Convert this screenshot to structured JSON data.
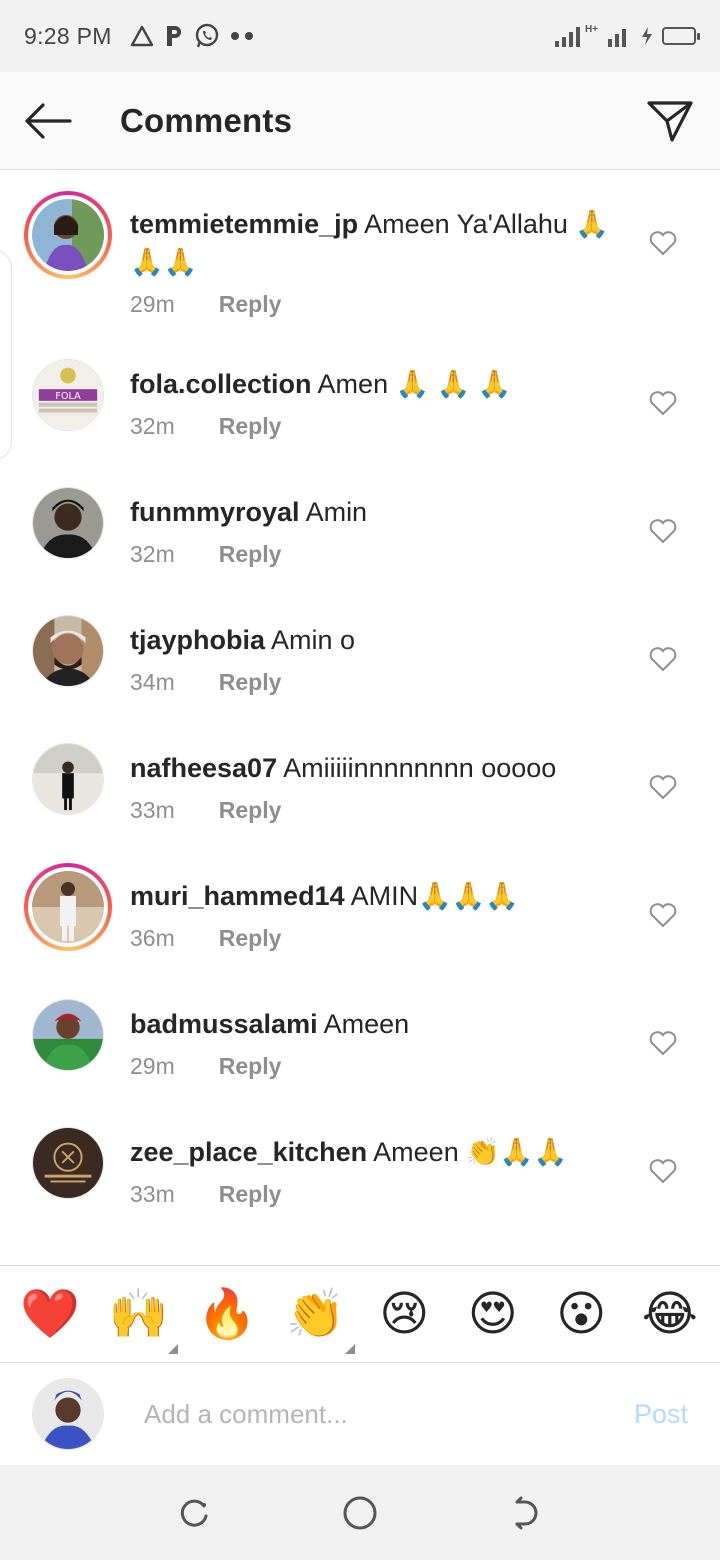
{
  "status_bar": {
    "time": "9:28 PM",
    "network": "H+",
    "icons": [
      "alert-triangle-icon",
      "p-app-icon",
      "whatsapp-icon",
      "more-dots-icon",
      "signal-icon",
      "battery-icon"
    ]
  },
  "header": {
    "title": "Comments",
    "back_icon": "arrow-left-icon",
    "share_icon": "paper-plane-icon"
  },
  "comments": [
    {
      "username": "temmietemmie_jp",
      "text": "Ameen Ya'Allahu 🙏🙏🙏",
      "time": "29m",
      "reply_label": "Reply",
      "has_story": true
    },
    {
      "username": "fola.collection",
      "text": "Amen 🙏 🙏 🙏",
      "time": "32m",
      "reply_label": "Reply",
      "has_story": false
    },
    {
      "username": "funmmyroyal",
      "text": "Amin",
      "time": "32m",
      "reply_label": "Reply",
      "has_story": false
    },
    {
      "username": "tjayphobia",
      "text": "Amin o",
      "time": "34m",
      "reply_label": "Reply",
      "has_story": false
    },
    {
      "username": "nafheesa07",
      "text": "Amiiiiinnnnnnnn ooooo",
      "time": "33m",
      "reply_label": "Reply",
      "has_story": false
    },
    {
      "username": "muri_hammed14",
      "text": "AMIN🙏🙏🙏",
      "time": "36m",
      "reply_label": "Reply",
      "has_story": true
    },
    {
      "username": "badmussalami",
      "text": "Ameen",
      "time": "29m",
      "reply_label": "Reply",
      "has_story": false
    },
    {
      "username": "zee_place_kitchen",
      "text": "Ameen 👏🙏🙏",
      "time": "33m",
      "reply_label": "Reply",
      "has_story": false
    }
  ],
  "reactions": [
    "❤️",
    "🙌",
    "🔥",
    "👏",
    "😢",
    "😍",
    "😮",
    "😂"
  ],
  "compose": {
    "placeholder": "Add a comment...",
    "post_label": "Post"
  },
  "colors": {
    "text": "#262626",
    "meta": "#8e8e8e",
    "post_disabled": "#b3dbff",
    "divider": "#dbdbdb",
    "status_bg": "#f2f2f2"
  }
}
